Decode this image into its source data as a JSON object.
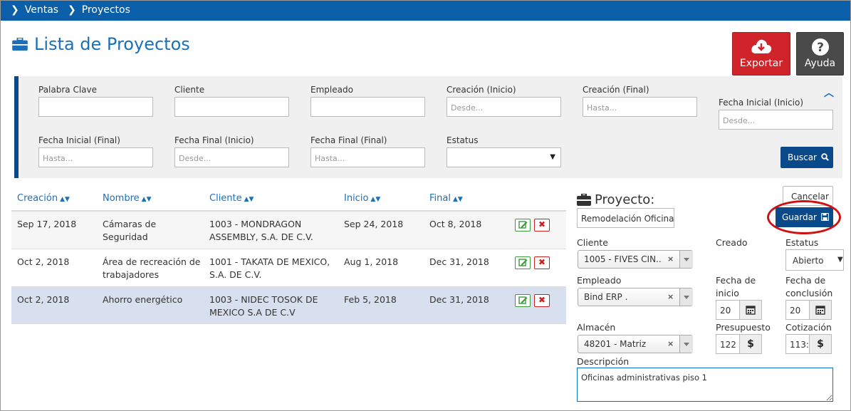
{
  "breadcrumb": {
    "items": [
      "Ventas",
      "Proyectos"
    ]
  },
  "page": {
    "title": "Lista de Proyectos"
  },
  "header_buttons": {
    "export": "Exportar",
    "help": "Ayuda"
  },
  "filters": {
    "palabra_clave": {
      "label": "Palabra Clave",
      "placeholder": ""
    },
    "cliente": {
      "label": "Cliente",
      "placeholder": ""
    },
    "empleado": {
      "label": "Empleado",
      "placeholder": ""
    },
    "creacion_inicio": {
      "label": "Creación (Inicio)",
      "placeholder": "Desde..."
    },
    "creacion_final": {
      "label": "Creación (Final)",
      "placeholder": "Hasta..."
    },
    "fecha_inicial_inicio": {
      "label": "Fecha Inicial (Inicio)",
      "placeholder": "Desde..."
    },
    "fecha_inicial_final": {
      "label": "Fecha Inicial (Final)",
      "placeholder": "Hasta..."
    },
    "fecha_final_inicio": {
      "label": "Fecha Final (Inicio)",
      "placeholder": "Desde..."
    },
    "fecha_final_final": {
      "label": "Fecha Final (Final)",
      "placeholder": "Hasta..."
    },
    "estatus": {
      "label": "Estatus",
      "value": ""
    },
    "search_button": "Buscar"
  },
  "table": {
    "headers": [
      "Creación",
      "Nombre",
      "Cliente",
      "Inicio",
      "Final"
    ],
    "rows": [
      {
        "creacion": "Sep 17, 2018",
        "nombre": "Cámaras de Seguridad",
        "cliente": "1003 - MONDRAGON ASSEMBLY, S.A. DE C.V.",
        "inicio": "Sep 24, 2018",
        "final": "Oct 8, 2018"
      },
      {
        "creacion": "Oct 2, 2018",
        "nombre": "Área de recreación de trabajadores",
        "cliente": "1001 - TAKATA DE MEXICO, S.A. DE C.V.",
        "inicio": "Aug 1, 2018",
        "final": "Dec 31, 2018"
      },
      {
        "creacion": "Oct 2, 2018",
        "nombre": "Ahorro energético",
        "cliente": "1003 - NIDEC TOSOK DE MEXICO S.A DE C.V",
        "inicio": "Feb 5, 2018",
        "final": "Dec 31, 2018"
      }
    ]
  },
  "project_panel": {
    "title": "Proyecto:",
    "cancel_button": "Cancelar",
    "save_button": "Guardar",
    "name_value": "Remodelación Oficinas",
    "cliente_label": "Cliente",
    "cliente_value": "1005 - FIVES CIN...",
    "creado_label": "Creado",
    "estatus_label": "Estatus",
    "estatus_value": "Abierto",
    "empleado_label": "Empleado",
    "empleado_value": "Bind ERP .",
    "fecha_inicio_label": "Fecha de inicio",
    "fecha_inicio_value": "20",
    "fecha_conclusion_label": "Fecha de conclusión",
    "fecha_conclusion_value": "20",
    "almacen_label": "Almacén",
    "almacen_value": "48201 - Matriz",
    "presupuesto_label": "Presupuesto",
    "presupuesto_value": "122",
    "cotizacion_label": "Cotización",
    "cotizacion_value": "113:",
    "currency_symbol": "$",
    "descripcion_label": "Descripción",
    "descripcion_value": "Oficinas administrativas piso 1"
  },
  "colors": {
    "topbar": "#0a5fa8",
    "primary": "#0a4a8a",
    "export": "#d0242b",
    "help": "#4a4a4a",
    "selected_row": "#d8dfee",
    "highlight_ring": "#d01010"
  }
}
